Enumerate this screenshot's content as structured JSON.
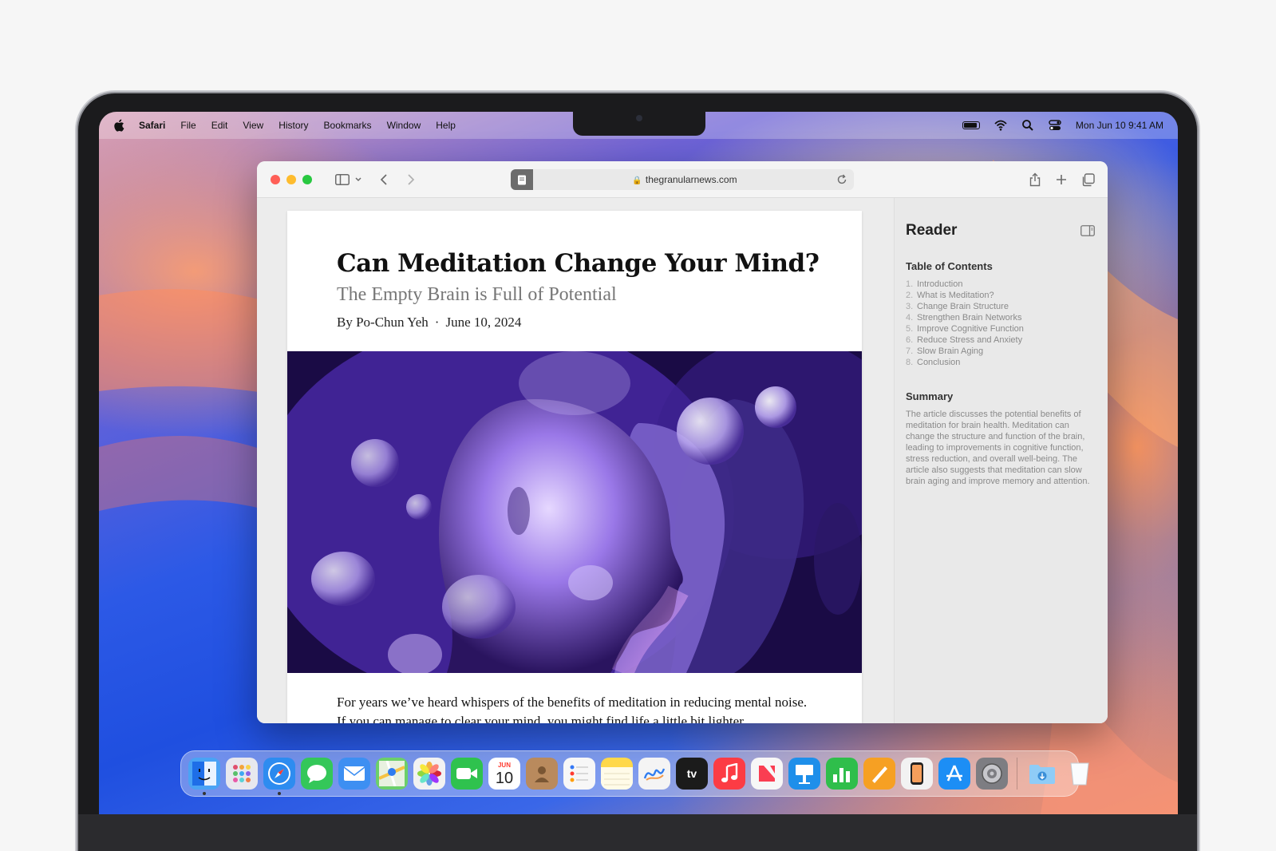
{
  "menubar": {
    "app": "Safari",
    "items": [
      "File",
      "Edit",
      "View",
      "History",
      "Bookmarks",
      "Window",
      "Help"
    ],
    "datetime": "Mon Jun 10  9:41 AM"
  },
  "browser": {
    "url": "thegranularnews.com"
  },
  "article": {
    "title": "Can Meditation Change Your Mind?",
    "subtitle": "The Empty Brain is Full of Potential",
    "author": "By Po-Chun Yeh",
    "date": "June 10, 2024",
    "body": "For years we’ve heard whispers of the benefits of meditation in reducing mental noise. If you can manage to clear your mind, you might find life a little bit lighter."
  },
  "reader": {
    "title": "Reader",
    "toc_heading": "Table of Contents",
    "toc": [
      {
        "n": "1.",
        "label": "Introduction"
      },
      {
        "n": "2.",
        "label": "What is Meditation?"
      },
      {
        "n": "3.",
        "label": "Change Brain Structure"
      },
      {
        "n": "4.",
        "label": "Strengthen Brain Networks"
      },
      {
        "n": "5.",
        "label": "Improve Cognitive Function"
      },
      {
        "n": "6.",
        "label": "Reduce Stress and Anxiety"
      },
      {
        "n": "7.",
        "label": "Slow Brain Aging"
      },
      {
        "n": "8.",
        "label": "Conclusion"
      }
    ],
    "summary_heading": "Summary",
    "summary": "The article discusses the potential benefits of meditation for brain health. Meditation can change the structure and function of the brain, leading to improvements in cognitive function, stress reduction, and overall well-being. The article also suggests that meditation can slow brain aging and improve memory and attention."
  },
  "dock": {
    "calendar_month": "JUN",
    "calendar_day": "10",
    "tv_label": "tv",
    "colors": {
      "finder": "#4aa3f5",
      "launchpad": "#e8e8ee",
      "safari": "#2d8cf0",
      "messages": "#34c759",
      "mail": "#3d8ff2",
      "maps": "#6ccf6a",
      "photos": "#f2f2f2",
      "facetime": "#2fc24e",
      "contacts": "#b98a5d",
      "reminders": "#f7f7f7",
      "notes": "#ffd84a",
      "freeform": "#f4f4f4",
      "tv": "#1b1b1b",
      "music": "#fc3c44",
      "news": "#f7f7f7",
      "keynote": "#1e8fea",
      "numbers": "#2fbe4b",
      "pages": "#f6a023",
      "iphone_mirroring": "#f2f2f2",
      "app_store": "#1c8ef5",
      "settings": "#7d7d82",
      "downloads": "#58b0f2",
      "trash": "#e9eef2"
    }
  }
}
